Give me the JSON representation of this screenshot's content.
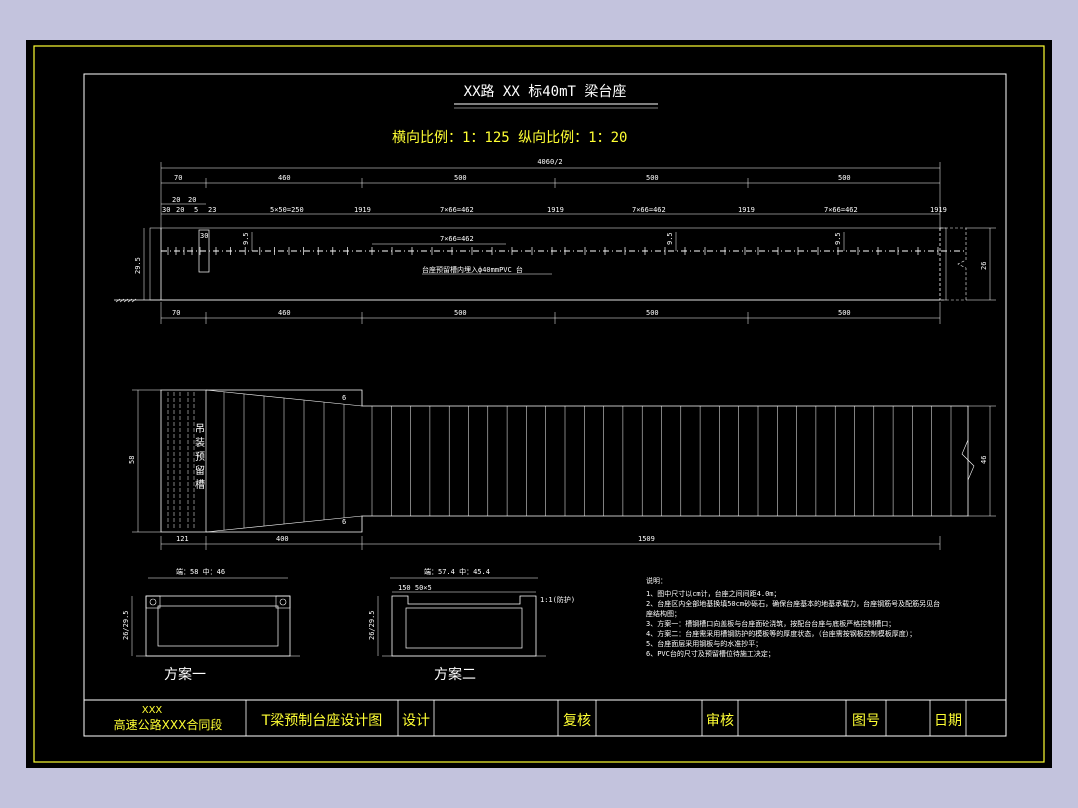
{
  "title": "XX路   XX 标40mT 梁台座",
  "scale_text": "横向比例：1：125    纵向比例：1：20",
  "elevation": {
    "top_total": "4060/2",
    "top_dims": [
      "70",
      "460",
      "500",
      "500",
      "500"
    ],
    "bottom_dims": [
      "70",
      "460",
      "500",
      "500",
      "500"
    ],
    "sub_dims": [
      "30",
      "20",
      "20",
      "5",
      "23",
      "5×50=250",
      "1919",
      "7×66=462",
      "1919",
      "7×66=462",
      "1919",
      "7×66=462",
      "1919"
    ],
    "inner_dim": "7×66=462",
    "left_height": "29.5",
    "right_height": "26",
    "small_label": "30",
    "tags": [
      "9.5",
      "9.5",
      "9.5"
    ],
    "note": "台座预留槽内埋入ф40mmPVC    台"
  },
  "plan": {
    "vertical_label": "吊装预留槽",
    "left_dim": "58",
    "right_dim": "46",
    "bottom_dims": [
      "121",
      "400",
      "1509"
    ]
  },
  "section1": {
    "top_label": "端：58    中：46",
    "left_dim": "26/29.5",
    "caption": "方案一"
  },
  "section2": {
    "top_label": "端：57.4    中：45.4",
    "left_dim": "26/29.5",
    "side_note": "1:1(防护)",
    "caption": "方案二"
  },
  "notes": {
    "heading": "说明：",
    "lines": [
      "1、图中尺寸以cm计，台座之间间距4.0m；",
      "2、台座区内全部地基换填50cm砂砾石，确保台座基本的地基承载力，台座钢筋号及配筋另见台",
      "座结构图；",
      "3、方案一：槽钢槽口向盖板与台座面砼浇筑，按配台台座与底板严格控制槽口；",
      "4、方案二：台座需采用槽钢防护的模板等的厚度状态，（台座需按钢板控制模板厚度）；",
      "5、台座面层采用钢板与的水准抄平；",
      "6、PVC台的尺寸及预留槽位待施工决定；"
    ]
  },
  "title_block": {
    "org_line1": "XXX",
    "org_line2": "高速公路XXX合同段",
    "drawing_name": "T梁预制台座设计图",
    "design": "设计",
    "review": "复核",
    "audit": "审核",
    "drawing_no": "图号",
    "date": "日期"
  },
  "colors": {
    "background": "#c3c3dd",
    "sheet": "#000000",
    "frame": "#ffff33",
    "lines": "#ffffff",
    "text_yellow": "#ffff33"
  }
}
